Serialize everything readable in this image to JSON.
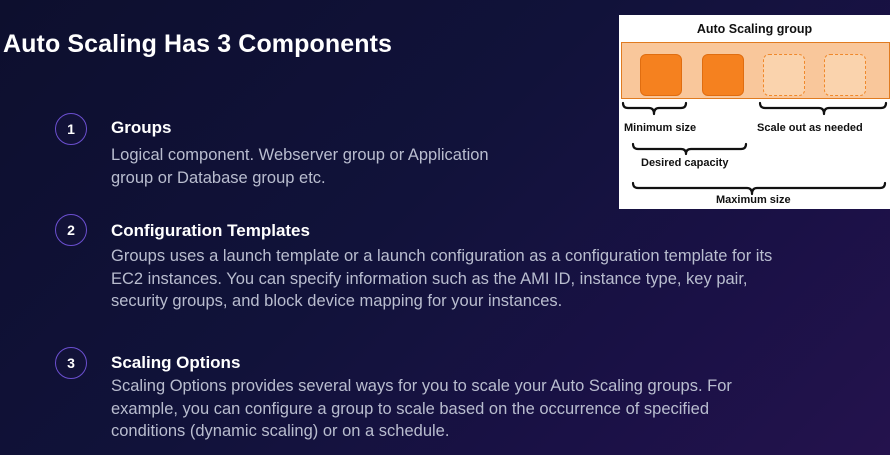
{
  "slide": {
    "title": "Auto Scaling Has 3 Components"
  },
  "items": [
    {
      "number": "1",
      "title": "Groups",
      "description_lines": [
        "Logical component. Webserver group or Application",
        "group or Database group etc."
      ]
    },
    {
      "number": "2",
      "title": "Configuration Templates",
      "description_lines": [
        "Groups uses a launch template or a launch configuration as a configuration template for its",
        "EC2 instances. You can specify information such as the AMI ID, instance type, key pair,",
        "security groups, and block device mapping for your instances."
      ]
    },
    {
      "number": "3",
      "title": "Scaling Options",
      "description_lines": [
        "Scaling Options provides several ways for you to scale your Auto Scaling groups. For",
        "example, you can configure a group to scale based on the occurrence of specified",
        "conditions (dynamic scaling) or on a schedule."
      ]
    }
  ],
  "diagram": {
    "title": "Auto Scaling group",
    "instances": [
      "running",
      "running",
      "potential",
      "potential"
    ],
    "labels": {
      "minimum": "Minimum size",
      "scale_out": "Scale out as needed",
      "desired": "Desired capacity",
      "maximum": "Maximum size"
    },
    "colors": {
      "band": "#f9c79b",
      "instance_running": "#f5811f",
      "instance_potential_border": "#f0882a"
    }
  }
}
